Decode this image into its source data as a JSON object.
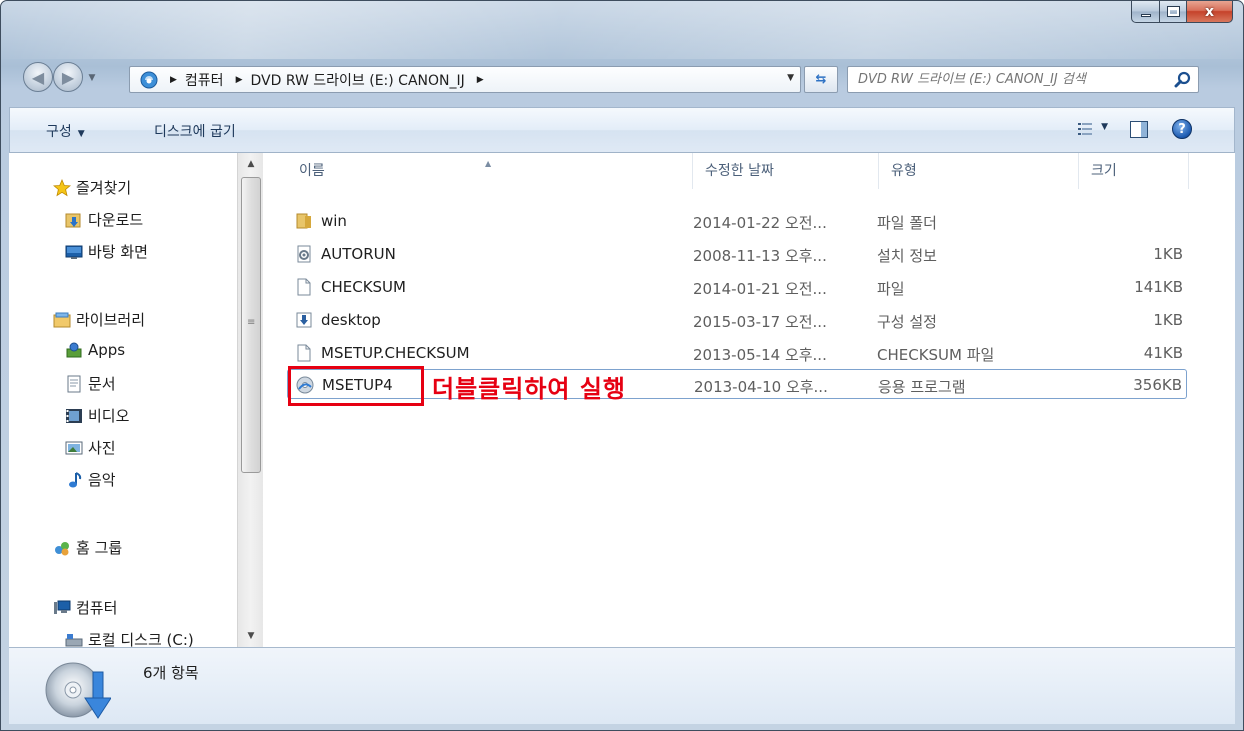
{
  "window": {
    "caption": {
      "minimize": "–",
      "maximize": "□",
      "close": "x"
    }
  },
  "nav": {
    "back_glyph": "◀",
    "forward_glyph": "▶",
    "address": {
      "segments": [
        "컴퓨터",
        "DVD RW 드라이브 (E:) CANON_IJ"
      ],
      "separator": "▶"
    },
    "search_placeholder": "DVD RW 드라이브 (E:) CANON_IJ 검색"
  },
  "toolbar": {
    "organize_label": "구성",
    "burn_label": "디스크에 굽기"
  },
  "sidebar": {
    "favorites": {
      "label": "즐겨찾기",
      "items": [
        "다운로드",
        "바탕 화면"
      ]
    },
    "libraries": {
      "label": "라이브러리",
      "items": [
        "Apps",
        "문서",
        "비디오",
        "사진",
        "음악"
      ]
    },
    "homegroup": {
      "label": "홈 그룹"
    },
    "computer": {
      "label": "컴퓨터",
      "items": [
        "로컬 디스크 (C:)"
      ]
    }
  },
  "file_list": {
    "columns": [
      "이름",
      "수정한 날짜",
      "유형",
      "크기"
    ],
    "rows": [
      {
        "name": "win",
        "date": "2014-01-22 오전...",
        "type": "파일 폴더",
        "size": "",
        "icon": "folder-icon"
      },
      {
        "name": "AUTORUN",
        "date": "2008-11-13 오후...",
        "type": "설치 정보",
        "size": "1KB",
        "icon": "setup-info-icon"
      },
      {
        "name": "CHECKSUM",
        "date": "2014-01-21 오전...",
        "type": "파일",
        "size": "141KB",
        "icon": "file-icon"
      },
      {
        "name": "desktop",
        "date": "2015-03-17 오전...",
        "type": "구성 설정",
        "size": "1KB",
        "icon": "config-settings-icon"
      },
      {
        "name": "MSETUP.CHECKSUM",
        "date": "2013-05-14 오후...",
        "type": "CHECKSUM 파일",
        "size": "41KB",
        "icon": "file-icon"
      },
      {
        "name": "MSETUP4",
        "date": "2013-04-10 오후...",
        "type": "응용 프로그램",
        "size": "356KB",
        "icon": "setup-disc-icon"
      }
    ],
    "selected_index": 5
  },
  "annotation": {
    "text": "더블클릭하여 실행",
    "color": "#e60012"
  },
  "details": {
    "item_count": "6개 항목"
  }
}
